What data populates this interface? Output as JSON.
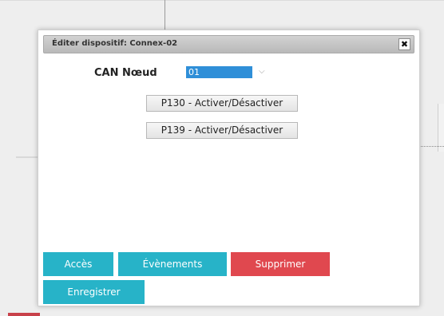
{
  "dialog": {
    "title": "Éditer dispositif: Connex-02",
    "close_label": "✖"
  },
  "can_node": {
    "label": "CAN Nœud",
    "selected_value": "01",
    "dropdown_icon": "chevron-down-icon"
  },
  "params": [
    {
      "label": "P130 - Activer/Désactiver"
    },
    {
      "label": "P139 - Activer/Désactiver"
    }
  ],
  "actions": {
    "acces": "Accès",
    "events": "Évènements",
    "delete": "Supprimer",
    "save": "Enregistrer"
  },
  "colors": {
    "primary": "#27b3c8",
    "danger": "#e0484f",
    "select_highlight": "#2f8fd8"
  }
}
